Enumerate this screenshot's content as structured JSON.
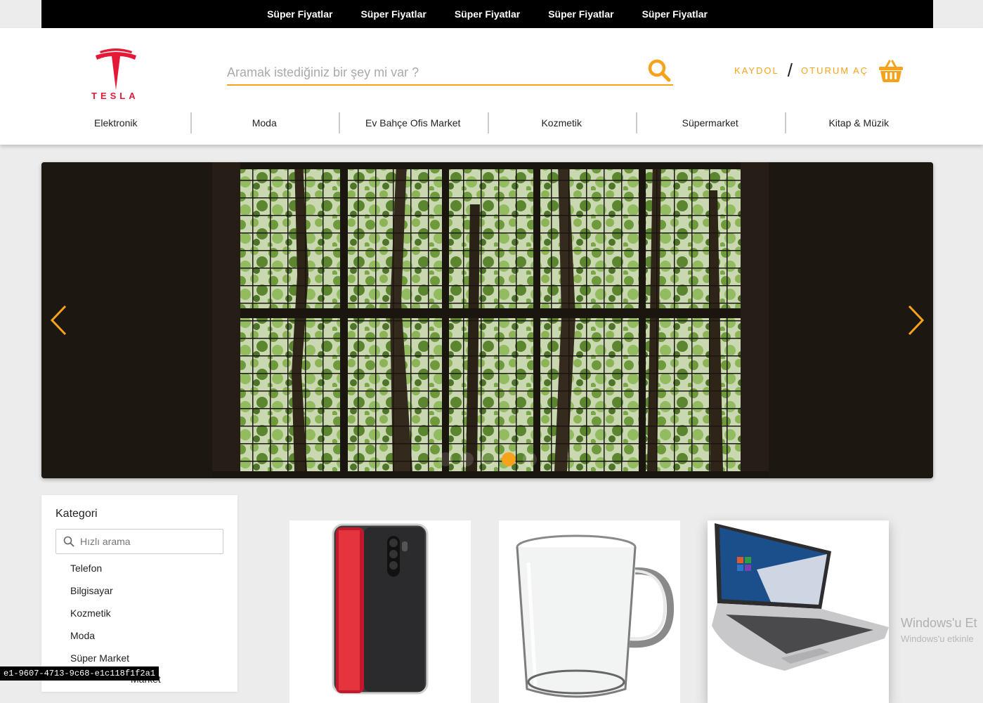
{
  "promo": {
    "links": [
      "Süper Fiyatlar",
      "Süper Fiyatlar",
      "Süper Fiyatlar",
      "Süper Fiyatlar",
      "Süper Fiyatlar"
    ]
  },
  "header": {
    "logo_text": "TESLA",
    "search_placeholder": "Aramak istediğiniz bir şey mi var ?",
    "register": "KAYDOL",
    "separator": "/",
    "login": "OTURUM AÇ",
    "categories": [
      "Elektronik",
      "Moda",
      "Ev Bahçe Ofis Market",
      "Kozmetik",
      "Süpermarket",
      "Kitap & Müzik"
    ]
  },
  "slider": {
    "slide_count": 1,
    "active_index": 0
  },
  "sidebar": {
    "title": "Kategori",
    "quick_search_placeholder": "Hızlı arama",
    "items": [
      "Telefon",
      "Bilgisayar",
      "Kozmetik",
      "Moda",
      "Süper Market"
    ],
    "partial_item": "Market"
  },
  "watermark": {
    "line1": "Windows'u Et",
    "line2": "Windows'u etkinle"
  },
  "status_tip": "e1-9607-4713-9c68-e1c118f1f2a1",
  "colors": {
    "accent": "#f7a21b",
    "brand": "#e31937",
    "promo_bg": "#000000"
  }
}
